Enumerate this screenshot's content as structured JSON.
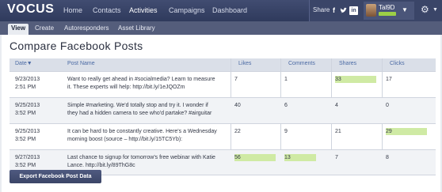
{
  "app": {
    "logo": "VOCUS"
  },
  "nav": {
    "items": [
      "Home",
      "Contacts",
      "Activities",
      "Campaigns",
      "Dashboard"
    ],
    "active": "Activities"
  },
  "share": {
    "label": "Share",
    "icons": [
      "facebook-icon",
      "twitter-icon",
      "linkedin-icon"
    ]
  },
  "user": {
    "name": "Tal9D"
  },
  "subnav": {
    "items": [
      "View",
      "Create",
      "Autoresponders",
      "Asset Library"
    ],
    "active": "View"
  },
  "page": {
    "title": "Compare Facebook Posts"
  },
  "table": {
    "columns": [
      "Date▼",
      "Post Name",
      "Likes",
      "Comments",
      "Shares",
      "Clicks"
    ],
    "rows": [
      {
        "date": "9/23/2013",
        "time": "2:51 PM",
        "post1": "Want to really get ahead in #socialmedia? Learn to measure",
        "post2": "it. These experts will help: http://bit.ly/1eJQOZm",
        "likes": "7",
        "comments": "1",
        "shares": "33",
        "clicks": "17"
      },
      {
        "date": "9/25/2013",
        "time": "3:52 PM",
        "post1": "Simple #marketing. We'd totally stop and try it. I wonder if",
        "post2": "they had a hidden camera to see who'd partake? #airguitar",
        "likes": "40",
        "comments": "6",
        "shares": "4",
        "clicks": "0"
      },
      {
        "date": "9/25/2013",
        "time": "3:52 PM",
        "post1": "It can be hard to be constantly creative. Here's a Wednesday",
        "post2": "morning boost (source – http://bit.ly/15TC5Yb):",
        "likes": "22",
        "comments": "9",
        "shares": "21",
        "clicks": "29"
      },
      {
        "date": "9/27/2013",
        "time": "3:52 PM",
        "post1": "Last chance to signup for tomorrow's free webinar with Katie",
        "post2": "Lance. http://bit.ly/89ThG8c",
        "likes": "56",
        "comments": "13",
        "shares": "7",
        "clicks": "8"
      }
    ]
  },
  "export": {
    "label": "Export Facebook Post Data"
  },
  "colors": {
    "highlight": "#cfeaa4",
    "nav_bg": "#2f3a5c",
    "link": "#4b6aa4"
  }
}
